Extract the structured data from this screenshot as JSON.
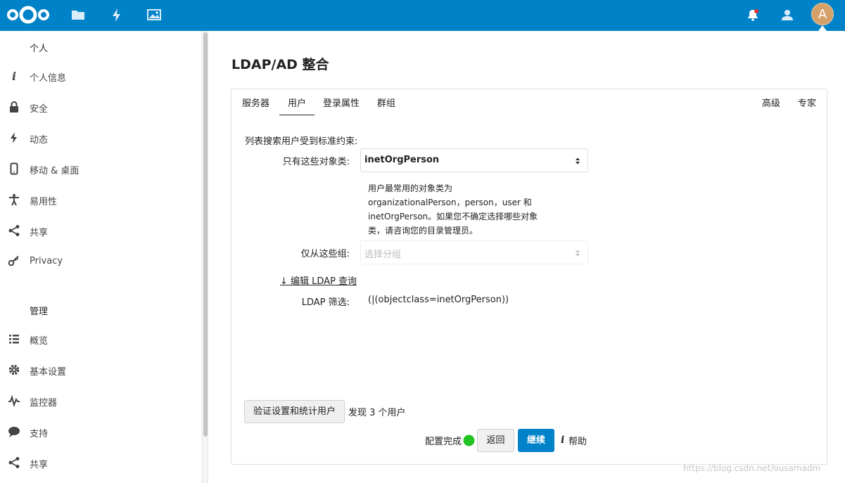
{
  "header": {
    "avatar_letter": "A",
    "brand_color": "#0082c9"
  },
  "sidebar": {
    "section_personal": "个人",
    "personal_items": [
      {
        "label": "个人信息",
        "icon": "info-icon"
      },
      {
        "label": "安全",
        "icon": "lock-icon"
      },
      {
        "label": "动态",
        "icon": "lightning-icon"
      },
      {
        "label": "移动 & 桌面",
        "icon": "phone-icon"
      },
      {
        "label": "易用性",
        "icon": "accessibility-icon"
      },
      {
        "label": "共享",
        "icon": "share-icon"
      },
      {
        "label": "Privacy",
        "icon": "key-icon"
      }
    ],
    "section_admin": "管理",
    "admin_items": [
      {
        "label": "概览",
        "icon": "list-icon"
      },
      {
        "label": "基本设置",
        "icon": "gear-icon"
      },
      {
        "label": "监控器",
        "icon": "pulse-icon"
      },
      {
        "label": "支持",
        "icon": "comment-icon"
      },
      {
        "label": "共享",
        "icon": "share-icon"
      }
    ]
  },
  "main": {
    "title": "LDAP/AD 整合",
    "tabs": [
      "服务器",
      "用户",
      "登录属性",
      "群组"
    ],
    "active_tab": "用户",
    "tabs_right": [
      "高级",
      "专家"
    ],
    "intro": "列表搜索用户受到标准约束:",
    "object_class_label": "只有这些对象类:",
    "object_class_value": "inetOrgPerson",
    "help_text": "用户最常用的对象类为 organizationalPerson，person，user 和 inetOrgPerson。如果您不确定选择哪些对象类，请咨询您的目录管理员。",
    "groups_label": "仅从这些组:",
    "groups_placeholder": "选择分组",
    "edit_query": "↓ 编辑 LDAP 查询",
    "filter_label": "LDAP 筛选:",
    "filter_value": "(|(objectclass=inetOrgPerson))",
    "verify_button": "验证设置和统计用户",
    "found_text": "发现 3 个用户",
    "config_status": "配置完成",
    "status_color": "#22c322",
    "back_button": "返回",
    "continue_button": "继续",
    "help_label": "帮助"
  },
  "watermark": "https://blog.csdn.net/ousamadm"
}
